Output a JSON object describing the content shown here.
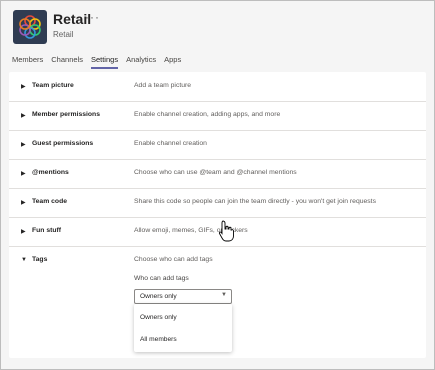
{
  "header": {
    "team_name": "Retail",
    "more_symbol": "···",
    "team_subtitle": "Retail",
    "logo_colors": [
      "#e74c3c",
      "#f1c40f",
      "#2ecc71",
      "#3498db",
      "#9b59b6",
      "#e67e22"
    ]
  },
  "tabs": [
    {
      "label": "Members",
      "active": false
    },
    {
      "label": "Channels",
      "active": false
    },
    {
      "label": "Settings",
      "active": true
    },
    {
      "label": "Analytics",
      "active": false
    },
    {
      "label": "Apps",
      "active": false
    }
  ],
  "settings": [
    {
      "label": "Team picture",
      "description": "Add a team picture"
    },
    {
      "label": "Member permissions",
      "description": "Enable channel creation, adding apps, and more"
    },
    {
      "label": "Guest permissions",
      "description": "Enable channel creation"
    },
    {
      "label": "@mentions",
      "description": "Choose who can use @team and @channel mentions"
    },
    {
      "label": "Team code",
      "description": "Share this code so people can join the team directly - you won't get join requests"
    },
    {
      "label": "Fun stuff",
      "description": "Allow emoji, memes, GIFs, or stickers"
    }
  ],
  "tags": {
    "label": "Tags",
    "description": "Choose who can add tags",
    "sublabel": "Who can add tags",
    "selected": "Owners only",
    "options": [
      "Owners only",
      "All members"
    ]
  },
  "colors": {
    "accent": "#6264a7",
    "background": "#f5f5f5",
    "panel": "#ffffff",
    "divider": "#e1dfdd"
  }
}
